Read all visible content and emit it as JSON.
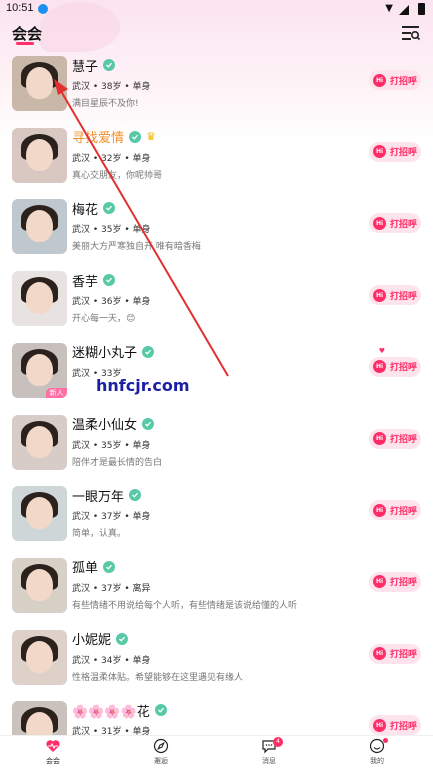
{
  "status_bar": {
    "time": "10:51"
  },
  "header": {
    "title": "会会"
  },
  "greet_label": "打招呼",
  "hi_badge": "Hi",
  "users": [
    {
      "name": "慧子",
      "info": "武汉 • 38岁 • 单身",
      "bio": "满目星辰不及你!",
      "crown": false,
      "tag": ""
    },
    {
      "name": "寻找爱情",
      "info": "武汉 • 32岁 • 单身",
      "bio": "真心交朋友，你呢帅哥",
      "crown": true,
      "tag": ""
    },
    {
      "name": "梅花",
      "info": "武汉 • 35岁 • 单身",
      "bio": "美丽大方严寒独自开 唯有暗香梅",
      "crown": false,
      "tag": ""
    },
    {
      "name": "香芋",
      "info": "武汉 • 36岁 • 单身",
      "bio": "开心每一天，😊",
      "crown": false,
      "tag": ""
    },
    {
      "name": "迷糊小丸子",
      "info": "武汉 • 33岁",
      "bio": "",
      "crown": false,
      "tag": "新人"
    },
    {
      "name": "温柔小仙女",
      "info": "武汉 • 35岁 • 单身",
      "bio": "陪伴才是最长情的告白",
      "crown": false,
      "tag": ""
    },
    {
      "name": "一眼万年",
      "info": "武汉 • 37岁 • 单身",
      "bio": "简单，认真。",
      "crown": false,
      "tag": ""
    },
    {
      "name": "孤单",
      "info": "武汉 • 37岁 • 离异",
      "bio": "有些情绪不用说给每个人听，有些情绪是该说给懂的人听",
      "crown": false,
      "tag": ""
    },
    {
      "name": "小妮妮",
      "info": "武汉 • 34岁 • 单身",
      "bio": "性格温柔体贴。希望能够在这里遇见有缘人",
      "crown": false,
      "tag": ""
    },
    {
      "name": "🌸🌸🌸🌸花",
      "info": "武汉 • 31岁 • 单身",
      "bio": "",
      "crown": false,
      "tag": ""
    }
  ],
  "watermark": "hnfcjr.com",
  "bottom_nav": [
    {
      "label": "会会",
      "icon": "heart-pulse-icon",
      "active": true
    },
    {
      "label": "邂逅",
      "icon": "compass-icon",
      "active": false
    },
    {
      "label": "消息",
      "icon": "chat-icon",
      "badge": "4",
      "active": false
    },
    {
      "label": "我的",
      "icon": "smiley-icon",
      "active": false
    }
  ],
  "colors": {
    "accent": "#ff2d67",
    "verified": "#58c9a7",
    "highlight_name": "#f2902a",
    "watermark": "#1b1fa6",
    "arrow": "#e03030"
  }
}
